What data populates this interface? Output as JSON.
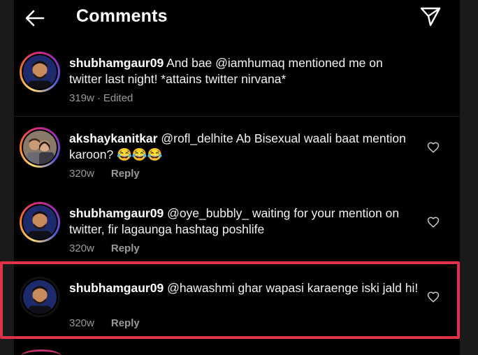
{
  "header": {
    "title": "Comments"
  },
  "comments": [
    {
      "username": "shubhamgaur09",
      "text": "And bae @iamhumaq mentioned me on twitter last night! *attains twitter nirvana*",
      "time": "319w",
      "edited": "Edited"
    },
    {
      "username": "akshaykanitkar",
      "text": "@rofl_delhite Ab Bisexual waali baat mention karoon? 😂😂😂",
      "time": "320w",
      "reply": "Reply"
    },
    {
      "username": "shubhamgaur09",
      "text": "@oye_bubbly_ waiting for your mention on twitter, fir lagaunga hashtag poshlife",
      "time": "320w",
      "reply": "Reply"
    },
    {
      "username": "shubhamgaur09",
      "text": "@hawashmi ghar wapasi karaenge iski jald hi!",
      "time": "320w",
      "reply": "Reply"
    }
  ],
  "colors": {
    "highlight": "#e0334a",
    "muted_text": "#9a9a9a"
  }
}
